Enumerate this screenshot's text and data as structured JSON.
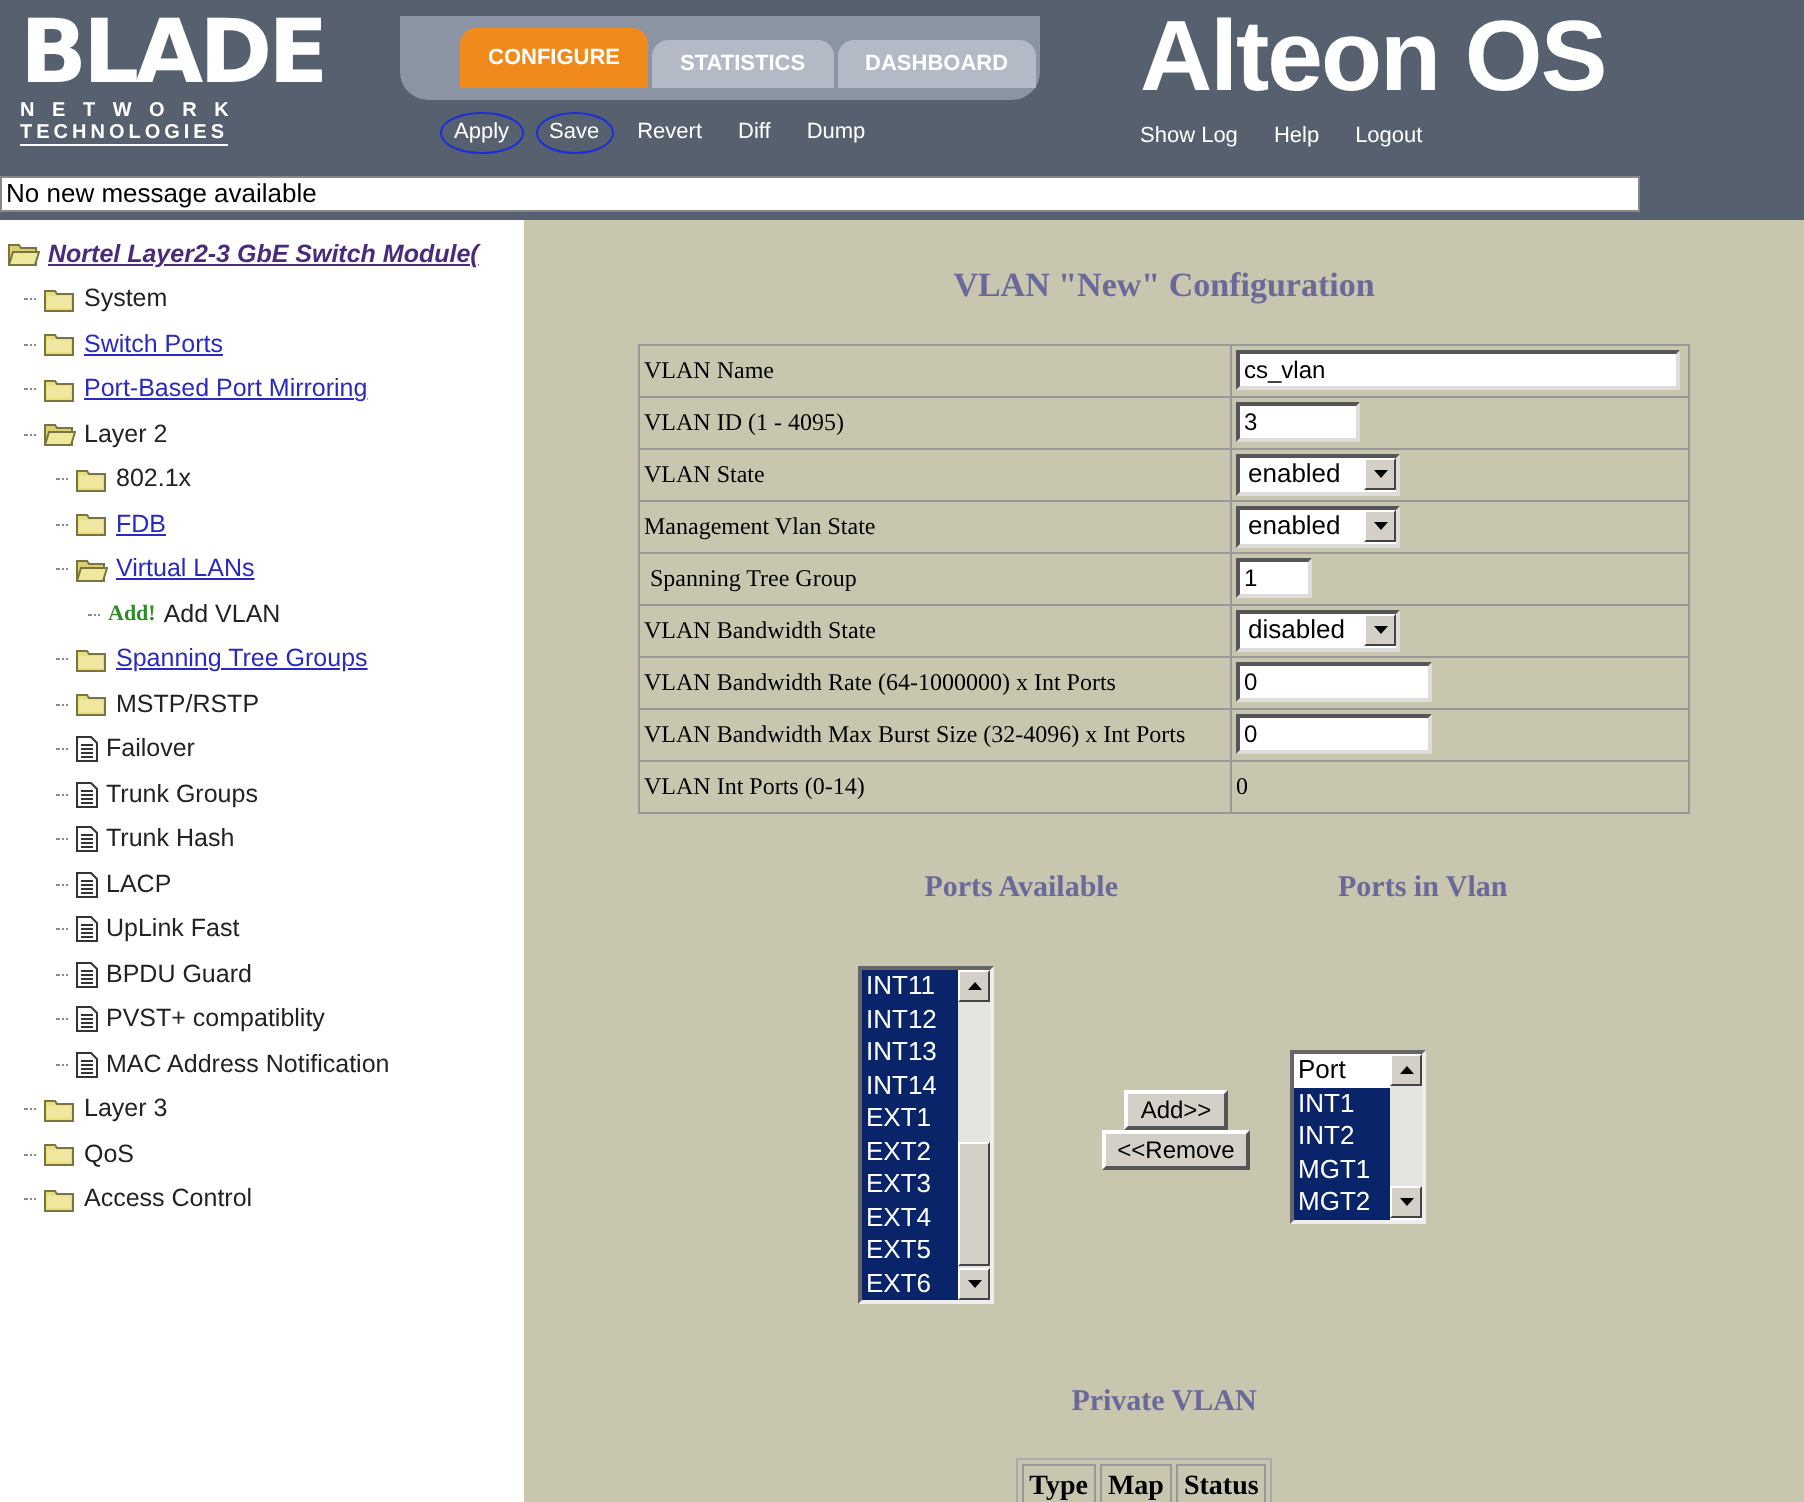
{
  "header": {
    "logo": {
      "title": "BLADE",
      "subtitle_1": "N E T W O R K",
      "subtitle_2": "TECHNOLOGIES"
    },
    "tabs": [
      {
        "label": "CONFIGURE",
        "selected": true
      },
      {
        "label": "STATISTICS",
        "selected": false
      },
      {
        "label": "DASHBOARD",
        "selected": false
      }
    ],
    "product": "Alteon OS",
    "actions": [
      {
        "label": "Apply",
        "circled": true
      },
      {
        "label": "Save",
        "circled": true
      },
      {
        "label": "Revert",
        "circled": false
      },
      {
        "label": "Diff",
        "circled": false
      },
      {
        "label": "Dump",
        "circled": false
      }
    ],
    "links": [
      "Show Log",
      "Help",
      "Logout"
    ]
  },
  "message": "No new message available",
  "tree": {
    "label": "Nortel Layer2-3 GbE Switch Module(",
    "kind": "folder",
    "expanded": true,
    "link": true,
    "children": [
      {
        "label": "System",
        "kind": "folder",
        "expanded": false,
        "link": false
      },
      {
        "label": "Switch Ports",
        "kind": "folder",
        "expanded": false,
        "link": true
      },
      {
        "label": "Port-Based Port Mirroring",
        "kind": "folder",
        "expanded": false,
        "link": true
      },
      {
        "label": "Layer 2",
        "kind": "folder",
        "expanded": true,
        "link": false,
        "children": [
          {
            "label": "802.1x",
            "kind": "folder",
            "expanded": false,
            "link": false
          },
          {
            "label": "FDB",
            "kind": "folder",
            "expanded": false,
            "link": true
          },
          {
            "label": "Virtual LANs",
            "kind": "folder",
            "expanded": true,
            "link": true,
            "children": [
              {
                "label": "Add VLAN",
                "kind": "add",
                "badge": "Add!",
                "link": false
              }
            ]
          },
          {
            "label": "Spanning Tree Groups",
            "kind": "folder",
            "expanded": false,
            "link": true
          },
          {
            "label": "MSTP/RSTP",
            "kind": "folder",
            "expanded": false,
            "link": false
          },
          {
            "label": "Failover",
            "kind": "page",
            "link": false
          },
          {
            "label": "Trunk Groups",
            "kind": "page",
            "link": false
          },
          {
            "label": "Trunk Hash",
            "kind": "page",
            "link": false
          },
          {
            "label": "LACP",
            "kind": "page",
            "link": false
          },
          {
            "label": "UpLink Fast",
            "kind": "page",
            "link": false
          },
          {
            "label": "BPDU Guard",
            "kind": "page",
            "link": false
          },
          {
            "label": "PVST+ compatiblity",
            "kind": "page",
            "link": false
          },
          {
            "label": "MAC Address Notification",
            "kind": "page",
            "link": false
          }
        ]
      },
      {
        "label": "Layer 3",
        "kind": "folder",
        "expanded": false,
        "link": false
      },
      {
        "label": "QoS",
        "kind": "folder",
        "expanded": false,
        "link": false
      },
      {
        "label": "Access Control",
        "kind": "folder",
        "expanded": false,
        "link": false
      }
    ]
  },
  "form": {
    "title": "VLAN \"New\" Configuration",
    "rows": [
      {
        "label": "VLAN Name",
        "kind": "wide-input",
        "value": "cs_vlan"
      },
      {
        "label": "VLAN ID (1 - 4095)",
        "kind": "short-input",
        "value": "3"
      },
      {
        "label": "VLAN State",
        "kind": "select",
        "value": "enabled"
      },
      {
        "label": "Management Vlan State",
        "kind": "select",
        "value": "enabled"
      },
      {
        "label": " Spanning Tree Group",
        "kind": "tiny-input",
        "value": "1"
      },
      {
        "label": "VLAN Bandwidth State",
        "kind": "select",
        "value": "disabled"
      },
      {
        "label": "VLAN Bandwidth Rate (64-1000000) x Int Ports",
        "kind": "medium-input",
        "value": "0"
      },
      {
        "label": "VLAN Bandwidth Max Burst Size (32-4096) x Int Ports",
        "kind": "medium-input",
        "value": "0"
      },
      {
        "label": "VLAN Int Ports (0-14)",
        "kind": "static",
        "value": "0"
      }
    ]
  },
  "ports": {
    "available_title": "Ports Available",
    "in_vlan_title": "Ports in Vlan",
    "available": [
      {
        "label": "INT11",
        "selected": true
      },
      {
        "label": "INT12",
        "selected": true
      },
      {
        "label": "INT13",
        "selected": true
      },
      {
        "label": "INT14",
        "selected": true
      },
      {
        "label": "EXT1",
        "selected": true
      },
      {
        "label": "EXT2",
        "selected": true
      },
      {
        "label": "EXT3",
        "selected": true
      },
      {
        "label": "EXT4",
        "selected": true
      },
      {
        "label": "EXT5",
        "selected": true
      },
      {
        "label": "EXT6",
        "selected": true
      }
    ],
    "buttons": [
      "Add>>",
      "<<Remove"
    ],
    "in_vlan": [
      {
        "label": "Port",
        "selected": false
      },
      {
        "label": "INT1",
        "selected": true
      },
      {
        "label": "INT2",
        "selected": true
      },
      {
        "label": "MGT1",
        "selected": true
      },
      {
        "label": "MGT2",
        "selected": true
      }
    ]
  },
  "private_vlan": {
    "title": "Private VLAN",
    "columns": [
      "Type",
      "Map",
      "Status"
    ]
  }
}
